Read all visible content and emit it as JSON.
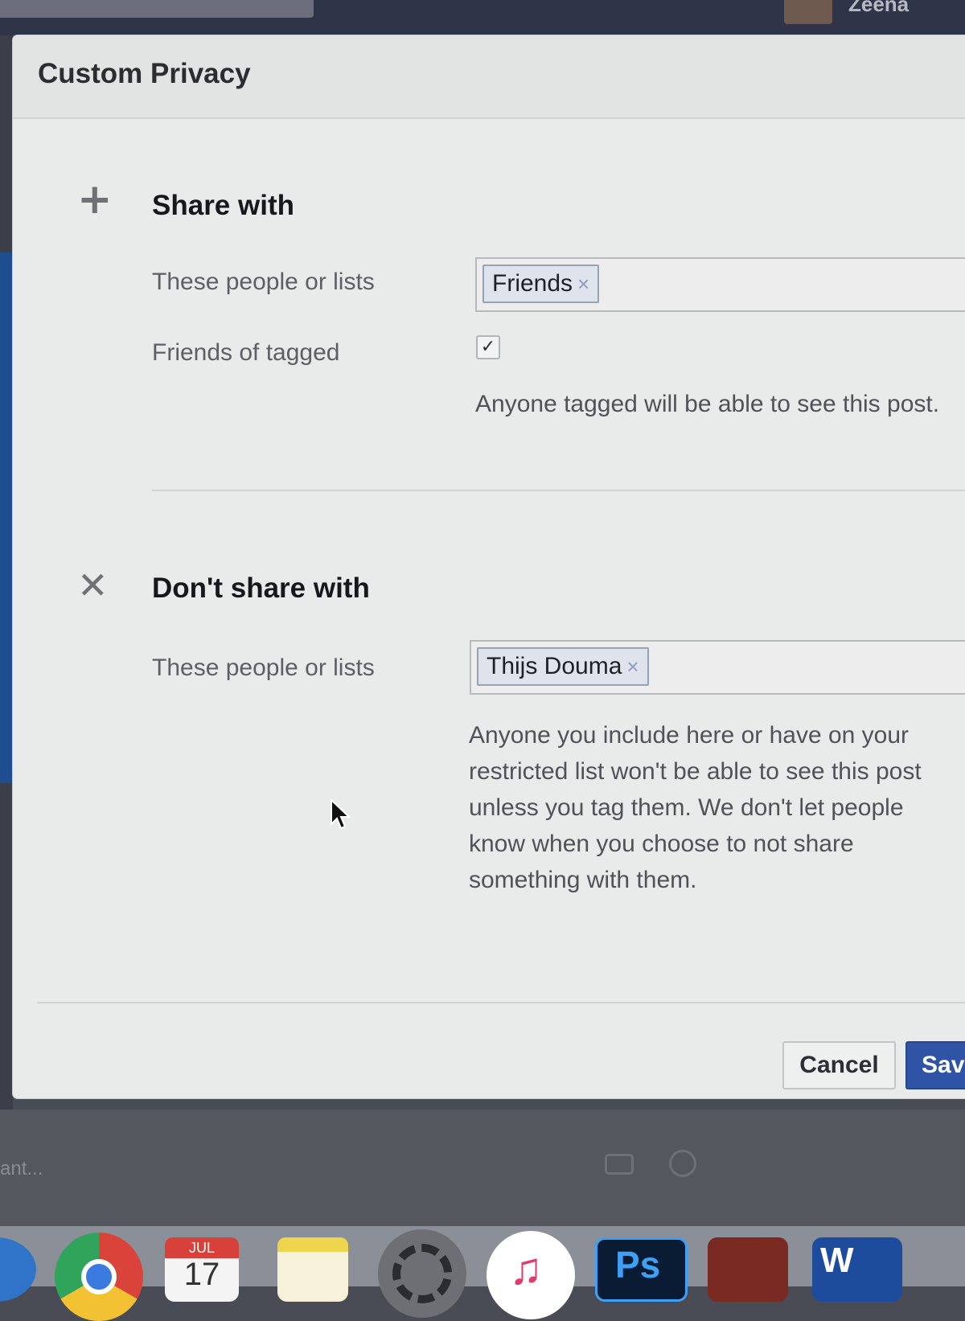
{
  "topbar": {
    "username": "Zeena"
  },
  "dialog": {
    "title": "Custom Privacy",
    "share_with": {
      "heading": "Share with",
      "people_label": "These people or lists",
      "token": "Friends",
      "token_remove": "×",
      "friends_of_tagged_label": "Friends of tagged",
      "friends_of_tagged_checked": true,
      "checkmark": "✓",
      "help": "Anyone tagged will be able to see this post."
    },
    "dont_share_with": {
      "heading": "Don't share with",
      "people_label": "These people or lists",
      "token": "Thijs Douma",
      "token_remove": "×",
      "help": "Anyone you include here or have on your restricted list won't be able to see this post unless you tag them. We don't let people know when you choose to not share something with them."
    },
    "buttons": {
      "cancel": "Cancel",
      "save": "Save"
    }
  },
  "background": {
    "composer_hint": "ant..."
  },
  "dock": {
    "calendar_month": "JUL",
    "calendar_day": "17",
    "photoshop_label": "Ps",
    "word_label": "W"
  },
  "icons": {
    "share_with": "plus-icon",
    "dont_share_with": "x-icon"
  },
  "colors": {
    "save_button": "#2f54a6",
    "token_bg": "#dfe3ec",
    "dialog_bg": "#e9ebea"
  }
}
